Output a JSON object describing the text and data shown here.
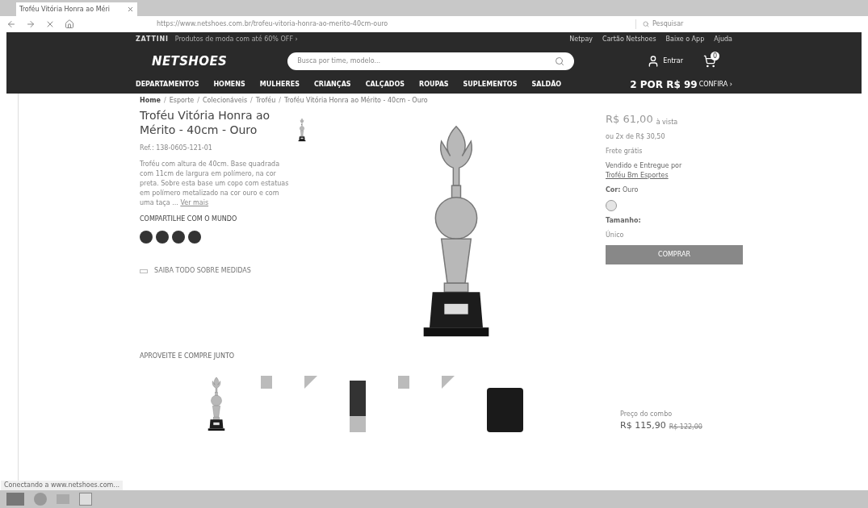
{
  "browser": {
    "tab_title": "Troféu Vitória Honra ao Méri",
    "url": "https://www.netshoes.com.br/trofeu-vitoria-honra-ao-merito-40cm-ouro",
    "search_placeholder": "Pesquisar"
  },
  "top_strip": {
    "brand": "ZATTINI",
    "promo": "Produtos de moda com até 60% OFF ›",
    "links": [
      "Netpay",
      "Cartão Netshoes",
      "Baixe o App",
      "Ajuda"
    ]
  },
  "header": {
    "logo": "NETSHOES",
    "search_placeholder": "Busca por time, modelo...",
    "login": "Entrar",
    "cart_badge": "0"
  },
  "nav": {
    "items": [
      "DEPARTAMENTOS",
      "HOMENS",
      "MULHERES",
      "CRIANÇAS",
      "CALÇADOS",
      "ROUPAS",
      "SUPLEMENTOS",
      "SALDÃO"
    ],
    "promo": "2 POR R$ 99",
    "promo_link": "CONFIRA ›"
  },
  "breadcrumb_separator": "/",
  "breadcrumb": [
    "Home",
    "Esporte",
    "Colecionáveis",
    "Troféu",
    "Troféu Vitória Honra ao Mérito - 40cm - Ouro"
  ],
  "product": {
    "title": "Troféu Vitória Honra ao Mérito - 40cm - Ouro",
    "code": "Ref.: 138-0605-121-01",
    "description": "Troféu com altura de 40cm. Base quadrada com 11cm de largura em polímero, na cor preta. Sobre esta base um copo com estatuas em polímero metalizado na cor ouro e com uma taça ...",
    "more": "Ver mais",
    "share_title": "COMPARTILHE COM O MUNDO",
    "size_guide": "SAIBA TODO SOBRE MEDIDAS"
  },
  "buy_box": {
    "price": "R$ 61,00",
    "price_note": "à vista",
    "installments": "ou 2x de R$ 30,50",
    "shipping": "Frete grátis",
    "seller_text": "Vendido e Entregue por",
    "seller": "Troféu Bm Esportes",
    "color_label": "Cor:",
    "color_value": "Ouro",
    "size_label": "Tamanho:",
    "size_value": "Único",
    "buy_button": "COMPRAR"
  },
  "together": {
    "title": "APROVEITE E COMPRE JUNTO",
    "price_note": "Preço do combo",
    "price": "R$ 115,90",
    "old_price": "R$ 122,00"
  },
  "status_bar": "Conectando a www.netshoes.com..."
}
